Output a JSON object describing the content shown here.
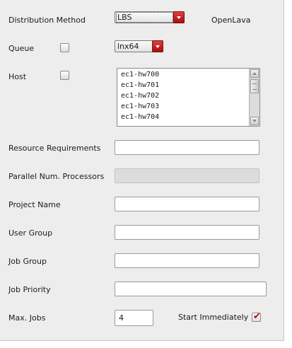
{
  "distribution": {
    "label": "Distribution Method",
    "value": "LBS",
    "scheduler": "OpenLava"
  },
  "queue": {
    "label": "Queue",
    "value": "lnx64"
  },
  "host": {
    "label": "Host",
    "items": [
      "ec1-hw700",
      "ec1-hw701",
      "ec1-hw702",
      "ec1-hw703",
      "ec1-hw704"
    ]
  },
  "fields": {
    "resource_requirements": {
      "label": "Resource Requirements",
      "value": ""
    },
    "parallel_processors": {
      "label": "Parallel Num. Processors",
      "value": ""
    },
    "project_name": {
      "label": "Project Name",
      "value": ""
    },
    "user_group": {
      "label": "User Group",
      "value": ""
    },
    "job_group": {
      "label": "Job Group",
      "value": ""
    },
    "job_priority": {
      "label": "Job Priority",
      "value": ""
    }
  },
  "max_jobs": {
    "label": "Max. Jobs",
    "value": "4"
  },
  "start_immediately": {
    "label": "Start Immediately",
    "checked": true
  },
  "colors": {
    "accent": "#c40000",
    "panel": "#ededed"
  }
}
